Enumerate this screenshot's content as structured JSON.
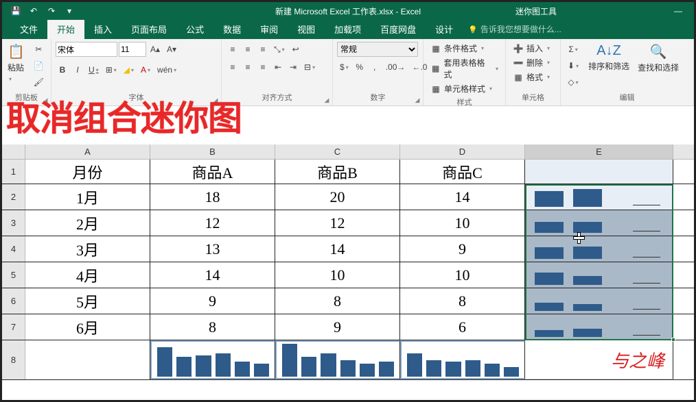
{
  "titlebar": {
    "main_title": "新建 Microsoft Excel 工作表.xlsx - Excel",
    "context_title": "迷你图工具"
  },
  "tabs": {
    "file": "文件",
    "home": "开始",
    "insert": "插入",
    "layout": "页面布局",
    "formulas": "公式",
    "data": "数据",
    "review": "审阅",
    "view": "视图",
    "addins": "加载项",
    "baidu": "百度网盘",
    "design": "设计",
    "tell": "告诉我您想要做什么..."
  },
  "ribbon": {
    "clipboard": {
      "label": "剪贴板",
      "paste": "粘贴"
    },
    "font": {
      "label": "字体",
      "name": "宋体",
      "size": "11",
      "wen": "wén"
    },
    "alignment": {
      "label": "对齐方式"
    },
    "number": {
      "label": "数字",
      "format": "常规"
    },
    "styles": {
      "label": "样式",
      "cond": "条件格式",
      "table": "套用表格格式",
      "cell": "单元格样式"
    },
    "cells": {
      "label": "单元格",
      "insert": "插入",
      "delete": "删除",
      "format": "格式"
    },
    "editing": {
      "label": "编辑",
      "sort": "排序和筛选",
      "find": "查找和选择"
    }
  },
  "overlay_title": "取消组合迷你图",
  "columns": [
    "A",
    "B",
    "C",
    "D",
    "E"
  ],
  "headers": {
    "month": "月份",
    "pA": "商品A",
    "pB": "商品B",
    "pC": "商品C"
  },
  "rows": [
    {
      "n": 1
    },
    {
      "n": 2,
      "month": "1月",
      "a": 18,
      "b": 20,
      "c": 14
    },
    {
      "n": 3,
      "month": "2月",
      "a": 12,
      "b": 12,
      "c": 10
    },
    {
      "n": 4,
      "month": "3月",
      "a": 13,
      "b": 14,
      "c": 9
    },
    {
      "n": 5,
      "month": "4月",
      "a": 14,
      "b": 10,
      "c": 10
    },
    {
      "n": 6,
      "month": "5月",
      "a": 9,
      "b": 8,
      "c": 8
    },
    {
      "n": 7,
      "month": "6月",
      "a": 8,
      "b": 9,
      "c": 6
    },
    {
      "n": 8
    }
  ],
  "chart_data": {
    "type": "bar",
    "description": "Column sparklines: row 8 has six mini bar charts summarizing each product column by month; column E has row-wise sparklines for each month across the three products.",
    "row_sparklines_E": [
      {
        "row": 2,
        "month": "1月",
        "values": [
          18,
          20,
          14
        ]
      },
      {
        "row": 3,
        "month": "2月",
        "values": [
          12,
          12,
          10
        ]
      },
      {
        "row": 4,
        "month": "3月",
        "values": [
          13,
          14,
          9
        ]
      },
      {
        "row": 5,
        "month": "4月",
        "values": [
          14,
          10,
          10
        ]
      },
      {
        "row": 6,
        "month": "5月",
        "values": [
          9,
          8,
          8
        ]
      },
      {
        "row": 7,
        "month": "6月",
        "values": [
          8,
          9,
          6
        ]
      }
    ],
    "column_sparklines_row8": [
      {
        "col": "B",
        "product": "商品A",
        "values": [
          18,
          12,
          13,
          14,
          9,
          8
        ]
      },
      {
        "col": "C",
        "product": "商品B",
        "values": [
          20,
          12,
          14,
          10,
          8,
          9
        ]
      },
      {
        "col": "D",
        "product": "商品C",
        "values": [
          14,
          10,
          9,
          10,
          8,
          6
        ]
      }
    ]
  },
  "signature": "与之峰"
}
